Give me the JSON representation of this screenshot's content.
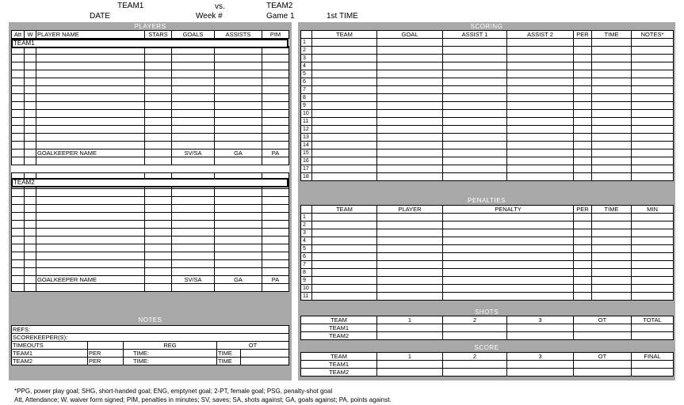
{
  "header": {
    "team1": "TEAM1",
    "vs": "vs.",
    "team2": "TEAM2",
    "date": "DATE",
    "week": "Week #",
    "game": "Game 1",
    "period": "1st TIME"
  },
  "players": {
    "title": "PLAYERS",
    "columns": [
      "Att",
      "W",
      "PLAYER NAME",
      "STARS",
      "GOALS",
      "ASSISTS",
      "PIM"
    ],
    "team1_label": "TEAM1",
    "team2_label": "TEAM2",
    "goalkeeper": {
      "name": "GOALKEEPER NAME",
      "sv_sa": "SV/SA",
      "ga": "GA",
      "pa": "PA"
    }
  },
  "scoring": {
    "title": "SCORING",
    "columns": [
      "TEAM",
      "GOAL",
      "ASSIST 1",
      "ASSIST 2",
      "PER",
      "TIME",
      "NOTES*"
    ],
    "rows": [
      "1",
      "2",
      "3",
      "4",
      "5",
      "6",
      "7",
      "8",
      "9",
      "10",
      "11",
      "12",
      "13",
      "14",
      "15",
      "16",
      "17",
      "18"
    ]
  },
  "penalties": {
    "title": "PENALTIES",
    "columns": [
      "TEAM",
      "PLAYER",
      "PENALTY",
      "PER",
      "TIME",
      "MIN"
    ],
    "rows": [
      "1",
      "2",
      "3",
      "4",
      "5",
      "6",
      "7",
      "8",
      "9",
      "10",
      "11"
    ]
  },
  "shots": {
    "title": "SHOTS",
    "columns": [
      "TEAM",
      "1",
      "2",
      "3",
      "OT",
      "TOTAL"
    ],
    "rows": [
      "TEAM1",
      "TEAM2"
    ]
  },
  "score": {
    "title": "SCORE",
    "columns": [
      "TEAM",
      "1",
      "2",
      "3",
      "OT",
      "FINAL"
    ],
    "rows": [
      "TEAM1",
      "TEAM2"
    ]
  },
  "notes": {
    "title": "NOTES",
    "refs": "REFS:",
    "scorekeepers": "SCOREKEEPER(S):",
    "timeouts": "TIMEOUTS",
    "reg": "REG",
    "ot": "OT",
    "team1": "TEAM1",
    "team2": "TEAM2",
    "per": "PER",
    "time_label": "TIME:",
    "time": "TIME"
  },
  "footer": {
    "line1": "*PPG, power play goal; SHG, short-handed goal; ENG, emptynet goal; 2-PT, female goal; PSG, penalty-shot goal",
    "line2": "Att, Attendance; W, waiver form signed; PIM, penalties in minutes; SV, saves; SA, shots against; GA, goals against; PA, points against."
  }
}
